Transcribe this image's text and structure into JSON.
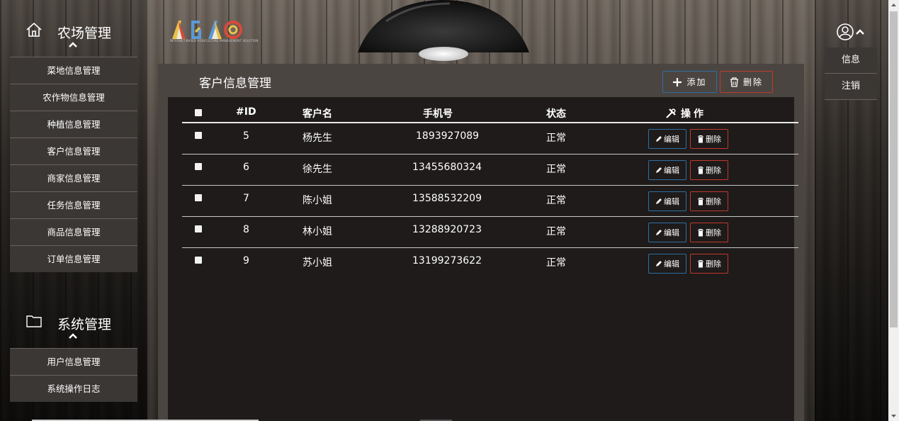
{
  "sidebar": {
    "group1": {
      "title": "农场管理",
      "items": [
        "菜地信息管理",
        "农作物信息管理",
        "种植信息管理",
        "客户信息管理",
        "商家信息管理",
        "任务信息管理",
        "商品信息管理",
        "订单信息管理"
      ]
    },
    "group2": {
      "title": "系统管理",
      "items": [
        "用户信息管理",
        "系统操作日志"
      ]
    }
  },
  "logo": {
    "subtitle": "INTERNET-BASED AGRICULTURE MANAGEMENT SOLUTION"
  },
  "panel": {
    "title": "客户信息管理",
    "add_label": "添加",
    "delete_label": "删除"
  },
  "table": {
    "headers": {
      "id": "#ID",
      "name": "客户名",
      "phone": "手机号",
      "status": "状态",
      "operation": "操作"
    },
    "rows": [
      {
        "id": "5",
        "name": "杨先生",
        "phone": "1893927089",
        "status": "正常"
      },
      {
        "id": "6",
        "name": "徐先生",
        "phone": "13455680324",
        "status": "正常"
      },
      {
        "id": "7",
        "name": "陈小姐",
        "phone": "13588532209",
        "status": "正常"
      },
      {
        "id": "8",
        "name": "林小姐",
        "phone": "13288920723",
        "status": "正常"
      },
      {
        "id": "9",
        "name": "苏小姐",
        "phone": "13199273622",
        "status": "正常"
      }
    ],
    "edit_label": "编辑",
    "delete_label": "删除"
  },
  "user_menu": {
    "items": [
      "信息",
      "注销"
    ]
  },
  "colors": {
    "primary_border": "#2f6ea3",
    "danger_border": "#c0392b",
    "table_bg": "#1e1b1a",
    "panel_bg": "#4b4541",
    "nav_bg": "#3b3735"
  }
}
